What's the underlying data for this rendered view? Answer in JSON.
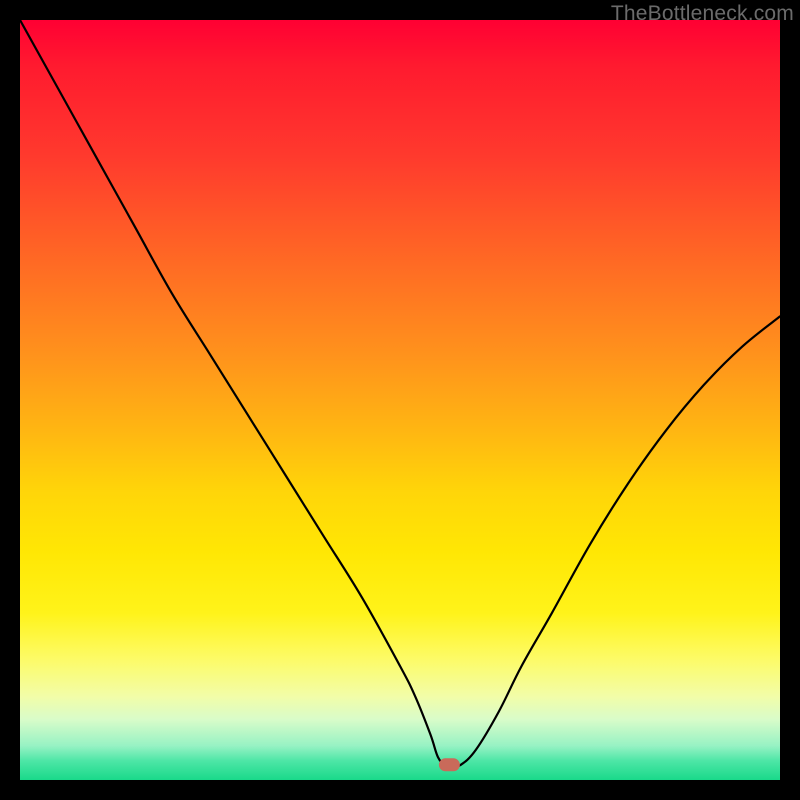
{
  "watermark": "TheBottleneck.com",
  "marker": {
    "x_pct": 56.5,
    "y_pct": 2
  },
  "chart_data": {
    "type": "line",
    "title": "",
    "xlabel": "",
    "ylabel": "",
    "xlim": [
      0,
      100
    ],
    "ylim": [
      0,
      100
    ],
    "grid": false,
    "legend": false,
    "annotations": [
      "Watermark top-right: TheBottleneck.com"
    ],
    "description": "Single V-shaped bottleneck curve over a red-to-green vertical gradient. Curve drops from top-left to a near-zero minimum around x≈56 and rises again toward the right. One rounded marker sits at the minimum.",
    "series": [
      {
        "name": "bottleneck-curve",
        "x": [
          0,
          5,
          10,
          15,
          20,
          25,
          30,
          35,
          40,
          45,
          50,
          52,
          54,
          55,
          56,
          57,
          58,
          60,
          63,
          66,
          70,
          75,
          80,
          85,
          90,
          95,
          100
        ],
        "values": [
          100,
          91,
          82,
          73,
          64,
          56,
          48,
          40,
          32,
          24,
          15,
          11,
          6,
          3,
          2,
          2,
          2,
          4,
          9,
          15,
          22,
          31,
          39,
          46,
          52,
          57,
          61
        ]
      }
    ]
  }
}
